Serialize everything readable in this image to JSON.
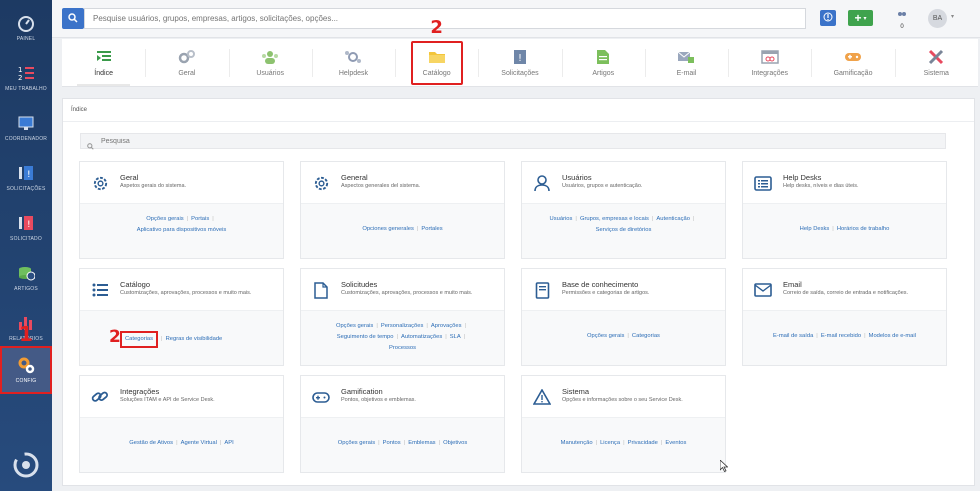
{
  "sidebar": {
    "items": [
      {
        "label": "PAINEL",
        "icon": "gauge-icon"
      },
      {
        "label": "MEU TRABALHO",
        "icon": "list-numbered-icon"
      },
      {
        "label": "COORDENADOR",
        "icon": "monitor-icon"
      },
      {
        "label": "SOLICITAÇÕES",
        "icon": "requests-icon"
      },
      {
        "label": "SOLICITADO",
        "icon": "requested-icon"
      },
      {
        "label": "ARTIGOS",
        "icon": "articles-icon"
      },
      {
        "label": "RELATÓRIOS",
        "icon": "bar-chart-icon"
      },
      {
        "label": "CONFIG",
        "icon": "gears-icon"
      }
    ],
    "marker": "1"
  },
  "topbar": {
    "search_placeholder": "Pesquise usuários, grupos, empresas, artigos, solicitações, opções...",
    "notifications_count": "0",
    "avatar_initials": "BA",
    "accent": "#3b73c9"
  },
  "tabs": [
    {
      "label": "Índice",
      "icon": "index-icon"
    },
    {
      "label": "Geral",
      "icon": "gears-icon"
    },
    {
      "label": "Usuários",
      "icon": "users-icon"
    },
    {
      "label": "Helpdesk",
      "icon": "helpdesk-icon"
    },
    {
      "label": "Catálogo",
      "icon": "folder-icon"
    },
    {
      "label": "Solicitações",
      "icon": "info-doc-icon"
    },
    {
      "label": "Artigos",
      "icon": "document-icon"
    },
    {
      "label": "E-mail",
      "icon": "mail-icon"
    },
    {
      "label": "Integrações",
      "icon": "link-box-icon"
    },
    {
      "label": "Gamificação",
      "icon": "gamepad-icon"
    },
    {
      "label": "Sistema",
      "icon": "tools-icon"
    }
  ],
  "tab_marker": "2",
  "breadcrumb": "Índice",
  "panel_search_placeholder": "Pesquisa",
  "cards": [
    {
      "title": "Geral",
      "desc": "Aspetos gerais do sistema.",
      "icon": "gear-icon",
      "links": [
        "Opções gerais",
        "Portais",
        "Aplicativo para dispositivos móveis"
      ]
    },
    {
      "title": "General",
      "desc": "Aspectos generales del sistema.",
      "icon": "gear-icon",
      "links": [
        "Opciones generales",
        "Portales"
      ]
    },
    {
      "title": "Usuários",
      "desc": "Usuários, grupos e autenticação.",
      "icon": "user-icon",
      "links": [
        "Usuários",
        "Grupos, empresas e locais",
        "Autenticação",
        "Serviços de diretórios"
      ]
    },
    {
      "title": "Help Desks",
      "desc": "Help desks, níveis e dias úteis.",
      "icon": "list-box-icon",
      "links": [
        "Help Desks",
        "Horários de trabalho"
      ]
    },
    {
      "title": "Catálogo",
      "desc": "Customizações, aprovações, processos e muito mais.",
      "icon": "list-icon",
      "links": [
        "Categorias",
        "Regras de visibilidade"
      ]
    },
    {
      "title": "Solicitudes",
      "desc": "Customizações, aprovações, processos e muito mais.",
      "icon": "file-icon",
      "links": [
        "Opções gerais",
        "Personalizações",
        "Aprovações",
        "Seguimento de tempo",
        "Automatizações",
        "SLA",
        "Processos"
      ]
    },
    {
      "title": "Base de conhecimento",
      "desc": "Permissões e categorias de artigos.",
      "icon": "book-icon",
      "links": [
        "Opções gerais",
        "Categorias"
      ]
    },
    {
      "title": "Email",
      "desc": "Correio de saída, correio de entrada e notificações.",
      "icon": "envelope-icon",
      "links": [
        "E-mail de saída",
        "E-mail recebido",
        "Modelos de e-mail"
      ]
    },
    {
      "title": "Integrações",
      "desc": "Soluções ITAM e API de Service Desk.",
      "icon": "chain-icon",
      "links": [
        "Gestão de Ativos",
        "Agente Virtual",
        "API"
      ]
    },
    {
      "title": "Gamification",
      "desc": "Pontos, objetivos e emblemas.",
      "icon": "gamepad-icon",
      "links": [
        "Opções gerais",
        "Pontos",
        "Emblemas",
        "Objetivos"
      ]
    },
    {
      "title": "Sistema",
      "desc": "Opções e informações sobre o seu Service Desk.",
      "icon": "warning-icon",
      "links": [
        "Manutenção",
        "Licença",
        "Privacidade",
        "Eventos"
      ]
    }
  ],
  "card_marker": "2"
}
